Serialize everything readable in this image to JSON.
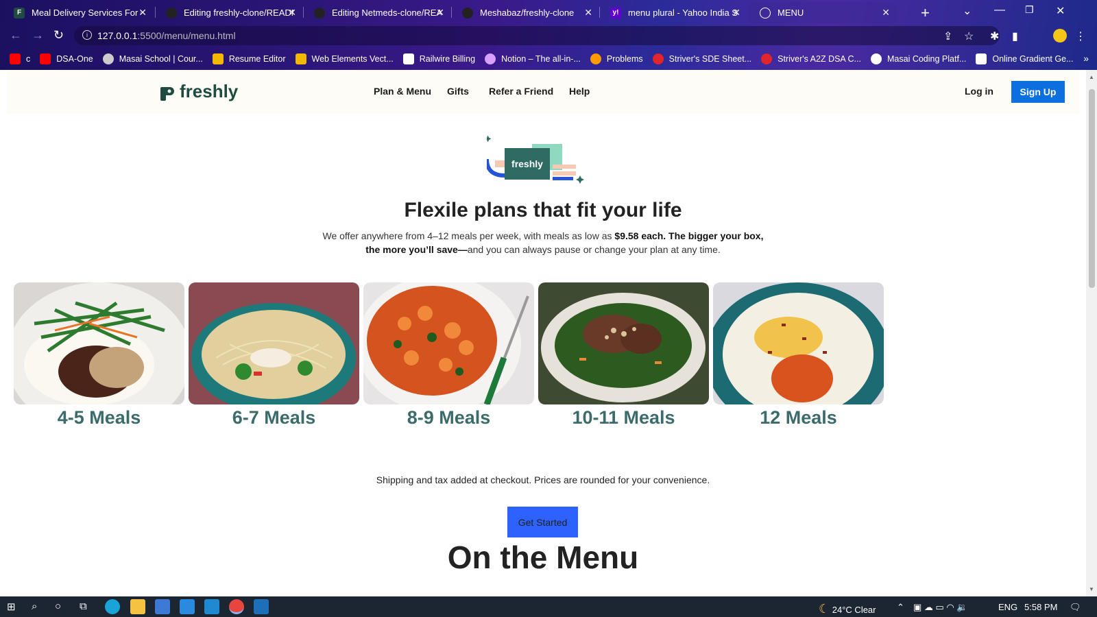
{
  "browser": {
    "tabs": [
      {
        "title": "Meal Delivery Services For Of",
        "icon": "freshly-favicon",
        "color": "#1f4b40",
        "active": false
      },
      {
        "title": "Editing freshly-clone/READMI",
        "icon": "github-favicon",
        "color": "#333333",
        "active": false
      },
      {
        "title": "Editing Netmeds-clone/READ",
        "icon": "github-favicon",
        "color": "#333333",
        "active": false
      },
      {
        "title": "Meshabaz/freshly-clone",
        "icon": "github-favicon",
        "color": "#333333",
        "active": false
      },
      {
        "title": "menu plural - Yahoo India Se",
        "icon": "yahoo-favicon",
        "color": "#6001d2",
        "active": false
      },
      {
        "title": "MENU",
        "icon": "globe-favicon",
        "color": "#ffffff",
        "active": true
      }
    ],
    "url_host": "127.0.0.1",
    "url_path": ":5500/menu/menu.html",
    "bookmarks": [
      {
        "label": "c",
        "color": "#ff0000"
      },
      {
        "label": "DSA-One",
        "color": "#ff0000"
      },
      {
        "label": "Masai School | Cour...",
        "color": "#cccccc"
      },
      {
        "label": "Resume Editor",
        "color": "#f5b800"
      },
      {
        "label": "Web Elements Vect...",
        "color": "#f5b800"
      },
      {
        "label": "Railwire Billing",
        "color": "#ffffff"
      },
      {
        "label": "Notion – The all-in-...",
        "color": "#d9a0ff"
      },
      {
        "label": "Problems",
        "color": "#ff9a00"
      },
      {
        "label": "Striver's SDE Sheet...",
        "color": "#e0252b"
      },
      {
        "label": "Striver's A2Z DSA C...",
        "color": "#e0252b"
      },
      {
        "label": "Masai Coding Platf...",
        "color": "#ffffff"
      },
      {
        "label": "Online Gradient Ge...",
        "color": "#ffffff"
      }
    ]
  },
  "site": {
    "logo_text": "freshly",
    "nav": [
      "Plan & Menu",
      "Gifts",
      "Refer a Friend",
      "Help"
    ],
    "login_label": "Log in",
    "signup_label": "Sign Up",
    "hero_badge": "freshly",
    "headline": "Flexile plans that fit your life",
    "sub_part1": "We offer anywhere from 4–12 meals per week, with meals as low as ",
    "sub_bold1": "$9.58 each. The bigger your box, the more you’ll save—",
    "sub_part2": "and you can always pause or change your plan at any time.",
    "plans": [
      {
        "label": "4-5 Meals",
        "dish": "steak-green-beans"
      },
      {
        "label": "6-7 Meals",
        "dish": "chicken-noodle-bowl"
      },
      {
        "label": "8-9 Meals",
        "dish": "pasta-marinara"
      },
      {
        "label": "10-11 Meals",
        "dish": "beef-kale-bowl"
      },
      {
        "label": "12 Meals",
        "dish": "chicken-mashed-potatoes"
      }
    ],
    "shipping_note": "Shipping and tax added at checkout. Prices are rounded for your convenience.",
    "cta_label": "Get Started",
    "section_title": "On the Menu",
    "accent_color": "#0b6fe0",
    "plan_label_color": "#3b6b6a"
  },
  "taskbar": {
    "weather": "24°C  Clear",
    "language": "ENG",
    "time": "5:58 PM"
  }
}
